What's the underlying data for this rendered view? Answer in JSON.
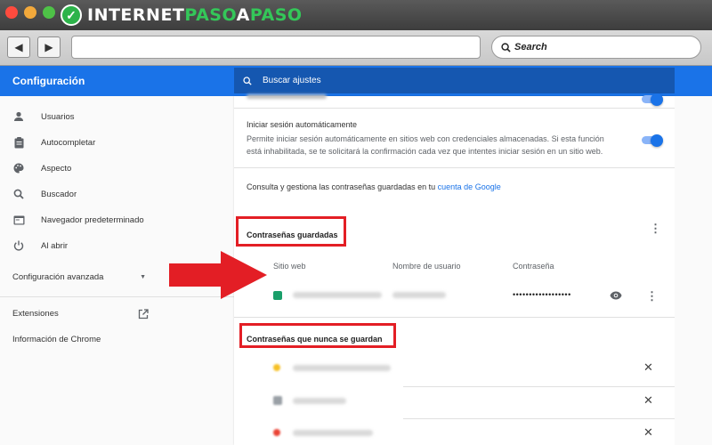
{
  "brand": {
    "logo_part1": "INTERNET",
    "logo_part2": "PASO",
    "logo_part3": "A",
    "logo_part4": "PASO",
    "accent": "#1a73e8",
    "highlight": "#e31e25"
  },
  "browser": {
    "search_label": "Search"
  },
  "app": {
    "title": "Configuración",
    "search_placeholder": "Buscar ajustes"
  },
  "sidebar": {
    "items": [
      {
        "label": "Usuarios",
        "icon": "person-icon"
      },
      {
        "label": "Autocompletar",
        "icon": "clipboard-icon"
      },
      {
        "label": "Aspecto",
        "icon": "palette-icon"
      },
      {
        "label": "Buscador",
        "icon": "search-icon"
      },
      {
        "label": "Navegador predeterminado",
        "icon": "browser-icon"
      },
      {
        "label": "Al abrir",
        "icon": "power-icon"
      }
    ],
    "advanced": "Configuración avanzada",
    "extensions": "Extensiones",
    "about": "Información de Chrome"
  },
  "main": {
    "autosignin_title": "Iniciar sesión automáticamente",
    "autosignin_desc_1": "Permite iniciar sesión automáticamente en sitios web con credenciales almacenadas. Si esta función",
    "autosignin_desc_2": "está inhabilitada, se te solicitará la confirmación cada vez que intentes iniciar sesión en un sitio web.",
    "manage_text": "Consulta y gestiona las contraseñas guardadas en tu",
    "manage_link": "cuenta de Google",
    "saved_title": "Contraseñas guardadas",
    "col_site": "Sitio web",
    "col_user": "Nombre de usuario",
    "col_pass": "Contraseña",
    "password_mask": "••••••••••••••••••",
    "never_title": "Contraseñas que nunca se guardan"
  }
}
